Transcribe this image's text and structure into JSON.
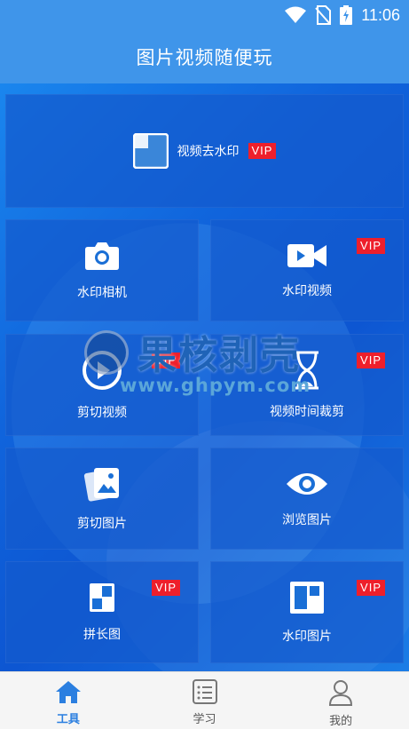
{
  "status_bar": {
    "time": "11:06"
  },
  "header": {
    "title": "图片视频随便玩"
  },
  "tools": {
    "remove_watermark": {
      "label": "视频去水印",
      "badge": "VIP"
    },
    "watermark_camera": {
      "label": "水印相机"
    },
    "watermark_video": {
      "label": "水印视频",
      "badge": "VIP"
    },
    "cut_video": {
      "label": "剪切视频",
      "badge": "VIP"
    },
    "video_trim": {
      "label": "视频时间裁剪",
      "badge": "VIP"
    },
    "cut_image": {
      "label": "剪切图片"
    },
    "browse_image": {
      "label": "浏览图片"
    },
    "long_image": {
      "label": "拼长图",
      "badge": "VIP"
    },
    "watermark_image": {
      "label": "水印图片",
      "badge": "VIP"
    }
  },
  "watermark": {
    "text": "果核剥壳",
    "url": "www.ghpym.com"
  },
  "tabbar": {
    "tabs": [
      {
        "label": "工具"
      },
      {
        "label": "学习"
      },
      {
        "label": "我的"
      }
    ]
  },
  "colors": {
    "primary": "#3f95ea",
    "vip": "#ee1f2b",
    "active_tab": "#2b7fe0"
  }
}
